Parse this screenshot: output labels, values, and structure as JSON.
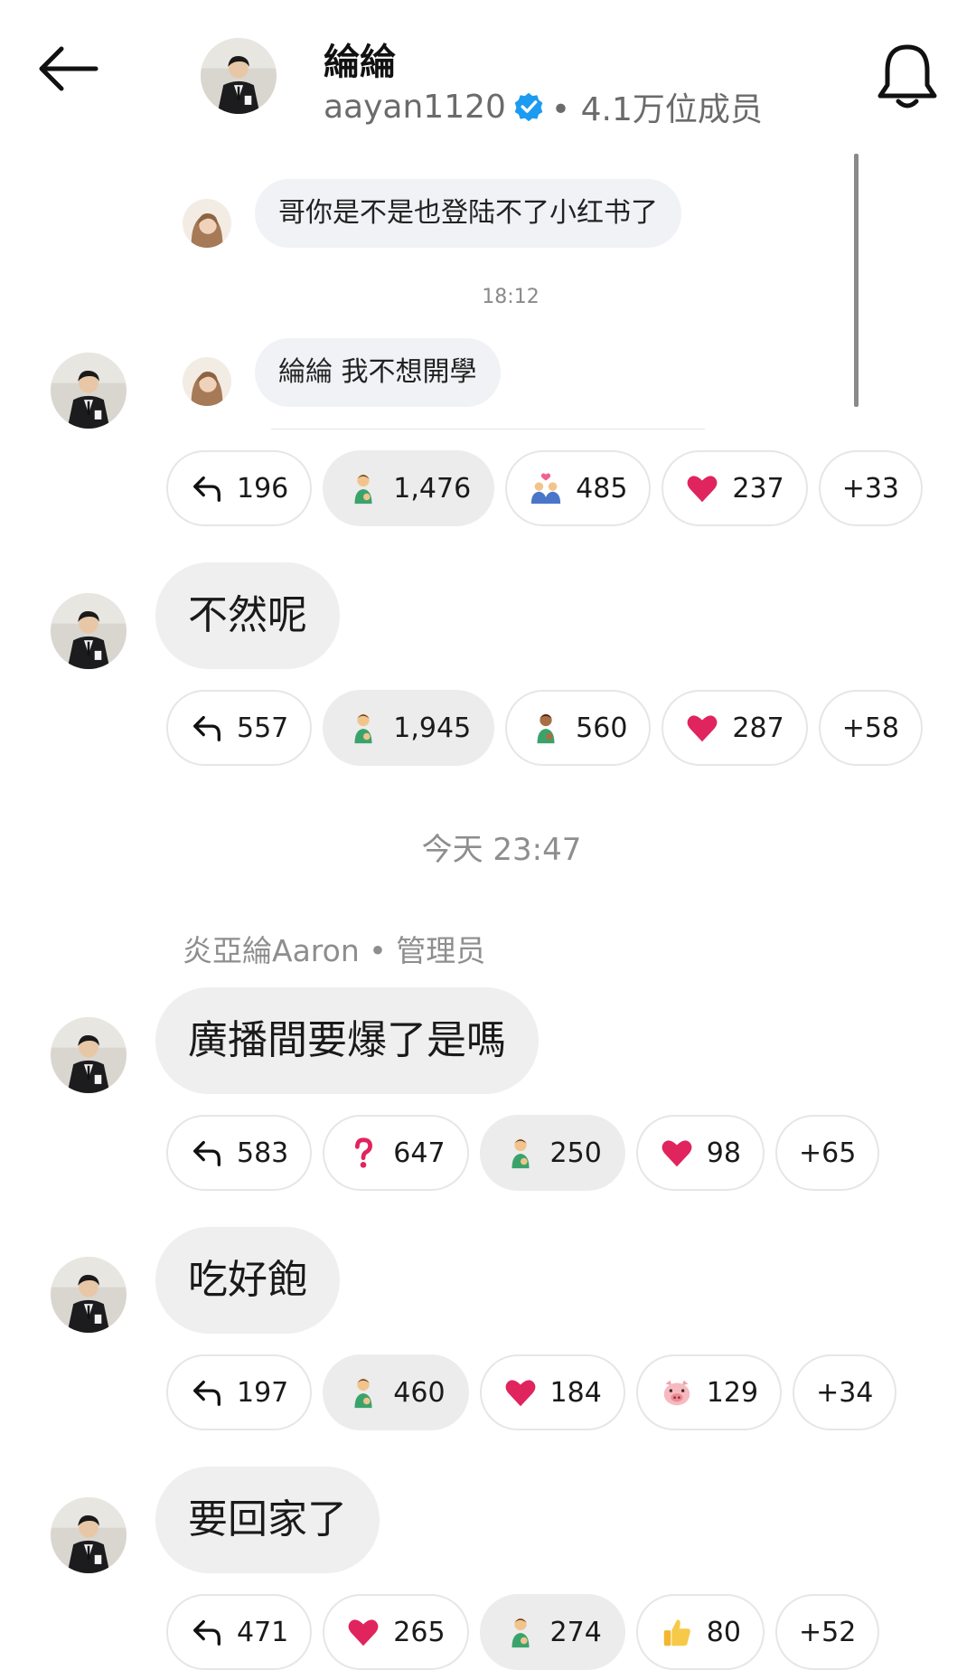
{
  "header": {
    "title": "綸綸",
    "handle": "aayan1120",
    "members": "• 4.1万位成员"
  },
  "quote": {
    "msg1": "哥你是不是也登陆不了小红书了",
    "time": "18:12",
    "msg2": "綸綸 我不想開學"
  },
  "messages": [
    {
      "text": "",
      "reactions": [
        {
          "icon": "reply-icon",
          "count": "196",
          "active": false
        },
        {
          "icon": "person-emoji-icon",
          "count": "1,476",
          "active": true
        },
        {
          "icon": "couple-emoji-icon",
          "count": "485",
          "active": false
        },
        {
          "icon": "heart-emoji-icon",
          "count": "237",
          "active": false
        },
        {
          "icon": "more",
          "count": "+33",
          "active": false
        }
      ]
    },
    {
      "text": "不然呢",
      "reactions": [
        {
          "icon": "reply-icon",
          "count": "557",
          "active": false
        },
        {
          "icon": "person-emoji-icon",
          "count": "1,945",
          "active": true
        },
        {
          "icon": "person-dark-emoji-icon",
          "count": "560",
          "active": false
        },
        {
          "icon": "heart-emoji-icon",
          "count": "287",
          "active": false
        },
        {
          "icon": "more",
          "count": "+58",
          "active": false
        }
      ]
    },
    {
      "text": "廣播間要爆了是嗎",
      "reactions": [
        {
          "icon": "reply-icon",
          "count": "583",
          "active": false
        },
        {
          "icon": "question-emoji-icon",
          "count": "647",
          "active": false
        },
        {
          "icon": "person-emoji-icon",
          "count": "250",
          "active": true
        },
        {
          "icon": "heart-emoji-icon",
          "count": "98",
          "active": false
        },
        {
          "icon": "more",
          "count": "+65",
          "active": false
        }
      ]
    },
    {
      "text": "吃好飽",
      "reactions": [
        {
          "icon": "reply-icon",
          "count": "197",
          "active": false
        },
        {
          "icon": "person-emoji-icon",
          "count": "460",
          "active": true
        },
        {
          "icon": "heart-emoji-icon",
          "count": "184",
          "active": false
        },
        {
          "icon": "pig-emoji-icon",
          "count": "129",
          "active": false
        },
        {
          "icon": "more",
          "count": "+34",
          "active": false
        }
      ]
    },
    {
      "text": "要回家了",
      "reactions": [
        {
          "icon": "reply-icon",
          "count": "471",
          "active": false
        },
        {
          "icon": "heart-emoji-icon",
          "count": "265",
          "active": false
        },
        {
          "icon": "person-emoji-icon",
          "count": "274",
          "active": true
        },
        {
          "icon": "thumbs-up-emoji-icon",
          "count": "80",
          "active": false
        },
        {
          "icon": "more",
          "count": "+52",
          "active": false
        }
      ]
    }
  ],
  "divider_time": "今天 23:47",
  "author_line": "炎亞綸Aaron • 管理员",
  "colors": {
    "verified": "#1d9bf0",
    "bubble": "#efefef",
    "heart": "#e0245e"
  }
}
